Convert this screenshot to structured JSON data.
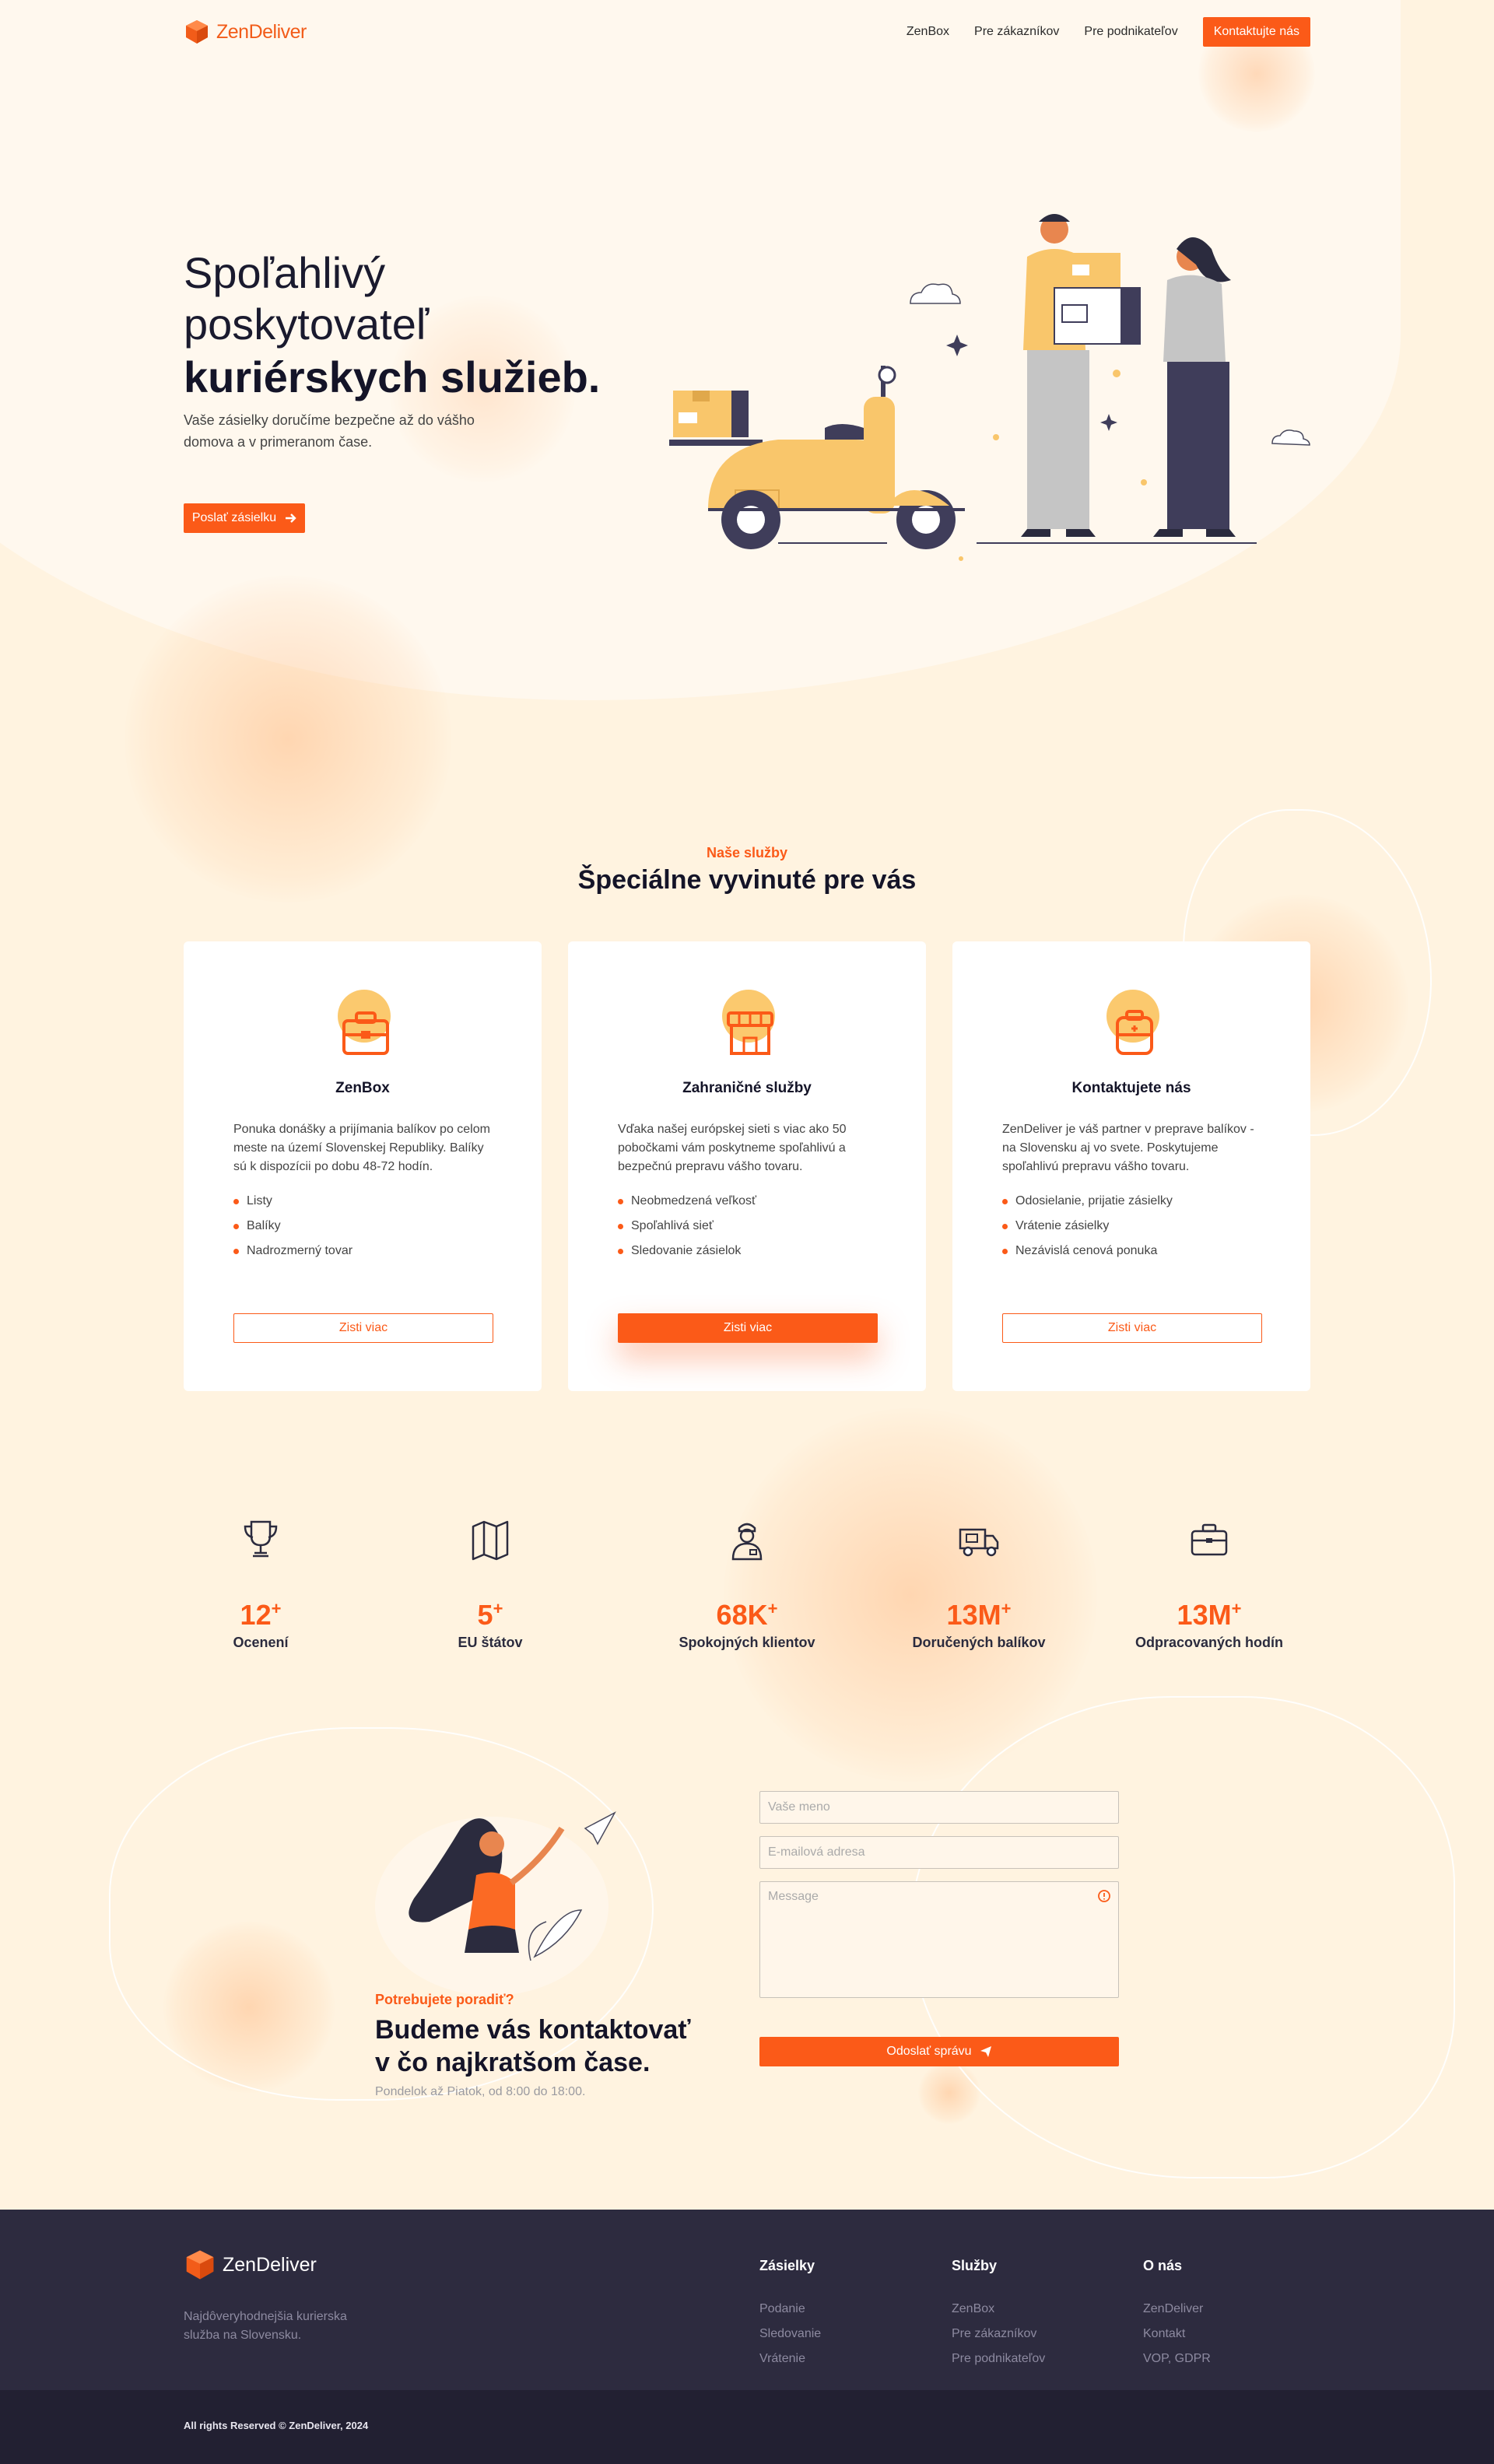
{
  "brand": {
    "name": "ZenDeliver",
    "accent": "#fb5a18"
  },
  "nav": {
    "links": [
      "ZenBox",
      "Pre zákazníkov",
      "Pre podnikateľov"
    ],
    "cta": "Kontaktujte nás"
  },
  "hero": {
    "line1": "Spoľahlivý",
    "line2": "poskytovateľ",
    "line3": "kuriérskych služieb.",
    "subtitle": "Vaše zásielky doručíme bezpečne až do vášho domova a v primeranom čase.",
    "button": "Poslať zásielku"
  },
  "services": {
    "kicker": "Naše služby",
    "title": "Špeciálne vyvinuté pre vás",
    "cards": [
      {
        "title": "ZenBox",
        "desc": "Ponuka donášky a prijímania balíkov po celom meste na území Slovenskej Republiky. Balíky sú k dispozícii po dobu 48-72 hodín.",
        "items": [
          "Listy",
          "Balíky",
          "Nadrozmerný tovar"
        ],
        "button": "Zisti viac",
        "icon": "briefcase-icon"
      },
      {
        "title": "Zahraničné služby",
        "desc": "Vďaka našej európskej sieti s viac ako 50 pobočkami vám poskytneme spoľahlivú a bezpečnú prepravu vášho tovaru.",
        "items": [
          "Neobmedzená veľkosť",
          "Spoľahlivá sieť",
          "Sledovanie zásielok"
        ],
        "button": "Zisti viac",
        "icon": "storefront-icon"
      },
      {
        "title": "Kontaktujete nás",
        "desc": "ZenDeliver je váš partner v preprave balíkov - na Slovensku aj vo svete. Poskytujeme spoľahlivú prepravu vášho tovaru.",
        "items": [
          "Odosielanie, prijatie zásielky",
          "Vrátenie zásielky",
          "Nezávislá cenová ponuka"
        ],
        "button": "Zisti viac",
        "icon": "backpack-icon"
      }
    ]
  },
  "stats": [
    {
      "value": "12",
      "suffix": "+",
      "label": "Ocenení",
      "icon": "trophy-icon"
    },
    {
      "value": "5",
      "suffix": "+",
      "label": "EU štátov",
      "icon": "map-icon"
    },
    {
      "value": "68K",
      "suffix": "+",
      "label": "Spokojných klientov",
      "icon": "courier-icon"
    },
    {
      "value": "13M",
      "suffix": "+",
      "label": "Doručených balíkov",
      "icon": "truck-icon"
    },
    {
      "value": "13M",
      "suffix": "+",
      "label": "Odpracovaných hodín",
      "icon": "briefcase-icon"
    }
  ],
  "contact": {
    "kicker": "Potrebujete poradiť?",
    "title_line1": "Budeme vás kontaktovať",
    "title_line2": "v čo najkratšom čase.",
    "hours": "Pondelok až Piatok, od 8:00 do 18:00.",
    "form": {
      "name_placeholder": "Vaše meno",
      "email_placeholder": "E-mailová adresa",
      "message_placeholder": "Message",
      "submit": "Odoslať správu"
    }
  },
  "footer": {
    "brand": "ZenDeliver",
    "tagline": "Najdôveryhodnejšia kurierska služba na Slovensku.",
    "columns": [
      {
        "title": "Zásielky",
        "links": [
          "Podanie",
          "Sledovanie",
          "Vrátenie"
        ]
      },
      {
        "title": "Služby",
        "links": [
          "ZenBox",
          "Pre zákazníkov",
          "Pre podnikateľov"
        ]
      },
      {
        "title": "O nás",
        "links": [
          "ZenDeliver",
          "Kontakt",
          "VOP, GDPR"
        ]
      }
    ],
    "copyright": "All rights Reserved © ZenDeliver, 2024"
  }
}
